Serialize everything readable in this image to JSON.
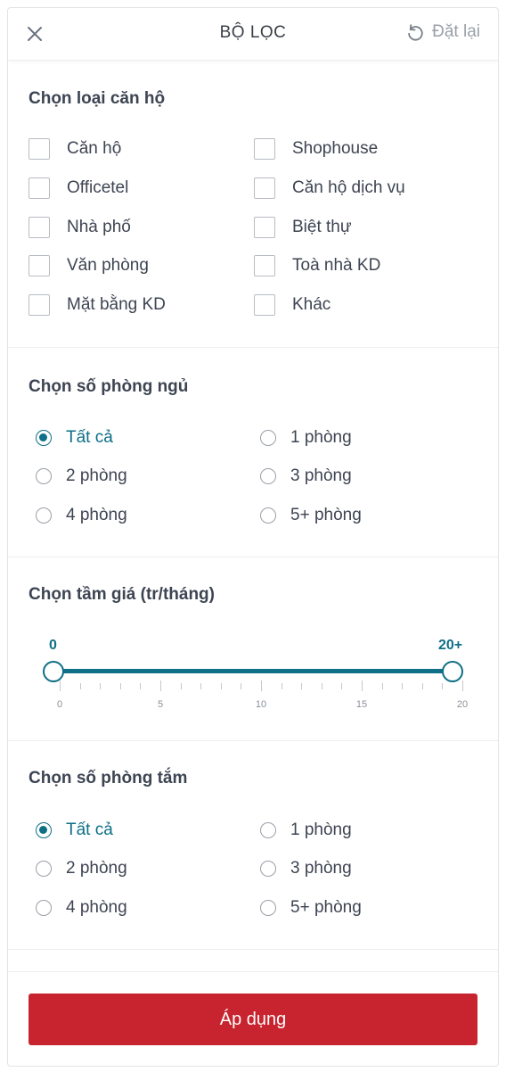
{
  "header": {
    "title": "BỘ LỌC",
    "reset_label": "Đặt lại"
  },
  "apartment_type": {
    "title": "Chọn loại căn hộ",
    "options": [
      "Căn hộ",
      "Shophouse",
      "Officetel",
      "Căn hộ dịch vụ",
      "Nhà phố",
      "Biệt thự",
      "Văn phòng",
      "Toà nhà KD",
      "Mặt bằng KD",
      "Khác"
    ],
    "checked": []
  },
  "bedrooms": {
    "title": "Chọn số phòng ngủ",
    "options": [
      "Tất cả",
      "1 phòng",
      "2 phòng",
      "3 phòng",
      "4 phòng",
      "5+ phòng"
    ],
    "selected": "Tất cả"
  },
  "price": {
    "title": "Chọn tầm giá (tr/tháng)",
    "min_label": "0",
    "max_label": "20+",
    "min_value": 0,
    "max_value": 20,
    "scale_labels": [
      "0",
      "5",
      "10",
      "15",
      "20"
    ]
  },
  "bathrooms": {
    "title": "Chọn số phòng tắm",
    "options": [
      "Tất cả",
      "1 phòng",
      "2 phòng",
      "3 phòng",
      "4 phòng",
      "5+ phòng"
    ],
    "selected": "Tất cả"
  },
  "footer": {
    "apply_label": "Áp dụng"
  },
  "colors": {
    "accent": "#0e6f86",
    "apply_button": "#c8242f"
  }
}
